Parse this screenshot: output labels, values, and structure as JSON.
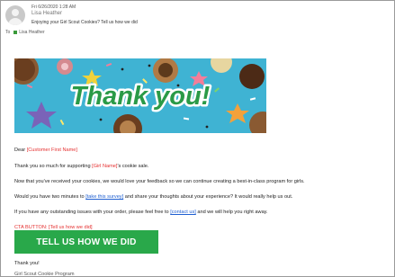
{
  "header": {
    "date": "Fri 6/26/2020 1:28 AM",
    "from": "Lisa Heather",
    "subject": "Enjoying your Girl Scout Cookies? Tell us how we did",
    "to_label": "To",
    "to_name": "Lisa Heather"
  },
  "banner": {
    "text": "Thank you!"
  },
  "body": {
    "greeting_prefix": "Dear ",
    "customer_placeholder": "[Customer First Name]",
    "thanks_prefix": "Thank you so much for supporting ",
    "girl_placeholder": "[Girl Name]",
    "thanks_suffix": "'s cookie sale.",
    "feedback_line": "Now that you've received your cookies, we would love your feedback so we can continue creating a best-in-class program for girls.",
    "survey_prefix": "Would you have two minutes to ",
    "survey_link": "[take this survey]",
    "survey_suffix": " and share your thoughts about your experience? It would really help us out.",
    "issues_prefix": "If you have any outstanding issues with your order, please feel free to ",
    "contact_link": "[contact us]",
    "issues_suffix": " and we will help you right away.",
    "cta_note": "CTA BUTTON: [Tell us how we did]",
    "cta_label": "TELL US HOW WE DID",
    "signoff": "Thank you!",
    "signature": "Girl Scout Cookie Program"
  },
  "colors": {
    "placeholder": "#e53030",
    "link": "#1f5fd1",
    "cta": "#29a84a"
  }
}
